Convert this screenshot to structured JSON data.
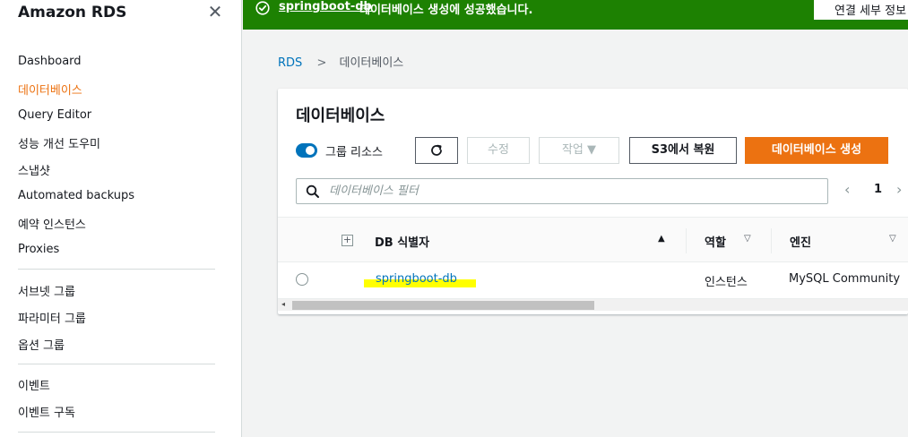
{
  "sidebar": {
    "title": "Amazon RDS",
    "close_glyph": "✕",
    "items": [
      {
        "label": "Dashboard"
      },
      {
        "label": "데이터베이스"
      },
      {
        "label": "Query Editor"
      },
      {
        "label": "성능 개선 도우미"
      },
      {
        "label": "스냅샷"
      },
      {
        "label": "Automated backups"
      },
      {
        "label": "예약 인스턴스"
      },
      {
        "label": "Proxies"
      },
      {
        "label": "서브넷 그룹"
      },
      {
        "label": "파라미터 그룹"
      },
      {
        "label": "옵션 그룹"
      },
      {
        "label": "이벤트"
      },
      {
        "label": "이벤트 구독"
      }
    ],
    "active_item": "데이터베이스"
  },
  "flash": {
    "link": "springboot-db",
    "message": "데이터베이스 생성에 성공했습니다.",
    "button": "연결 세부 정보 보기",
    "icon": "success-check-icon"
  },
  "breadcrumb": {
    "root": "RDS",
    "separator": ">",
    "current": "데이터베이스"
  },
  "panel": {
    "title": "데이터베이스",
    "toggle_label": "그룹 리소스",
    "toggle_on": true,
    "buttons": {
      "refresh_glyph": "↻",
      "edit": "수정",
      "actions": "작업 ▼",
      "restore_s3": "S3에서 복원",
      "create": "데이터베이스 생성"
    },
    "search": {
      "placeholder": "데이터베이스 필터",
      "value": ""
    },
    "pagination": {
      "prev": "‹",
      "page": "1",
      "next": "›"
    }
  },
  "table": {
    "columns": [
      {
        "label": "DB 식별자",
        "sort": "▲"
      },
      {
        "label": "역할",
        "sort": "▽"
      },
      {
        "label": "엔진",
        "sort": "▽"
      }
    ],
    "expand_glyph": "+",
    "rows": [
      {
        "id": "springboot-db",
        "role": "인스턴스",
        "engine": "MySQL Community"
      }
    ]
  },
  "scrollbar": {
    "left_arrow": "◂"
  },
  "colors": {
    "accent": "#ec7211",
    "link": "#0073bb",
    "success": "#1d8102",
    "highlight": "#ffff00"
  }
}
